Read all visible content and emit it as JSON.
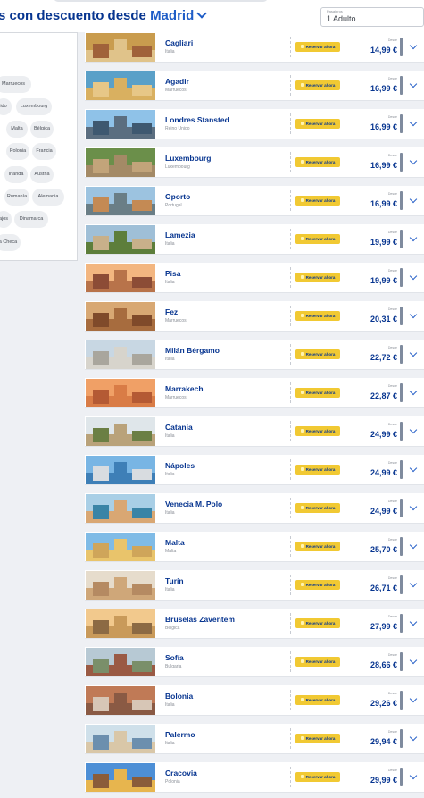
{
  "header": {
    "title_prefix": "s con descuento desde",
    "origin": "Madrid",
    "passengers_label": "Pasajeros",
    "passengers_value": "1 Adulto"
  },
  "filters": [
    {
      "label": "Marruecos"
    },
    {
      "label": "ido"
    },
    {
      "label": "Luxembourg"
    },
    {
      "label": "Malta"
    },
    {
      "label": "Bélgica"
    },
    {
      "label": "Polonia"
    },
    {
      "label": "Francia"
    },
    {
      "label": "Irlanda"
    },
    {
      "label": "Austria"
    },
    {
      "label": "Rumanía"
    },
    {
      "label": "Alemania"
    },
    {
      "label": "ajos"
    },
    {
      "label": "Dinamarca"
    },
    {
      "label": "a Checa"
    }
  ],
  "common": {
    "book_label": "Reservar ahora",
    "from_label": "Desde"
  },
  "destinations": [
    {
      "name": "Cagliari",
      "country": "Italia",
      "price": "14,99 €",
      "colors": [
        "#c99c4e",
        "#e0c38a",
        "#a0623a"
      ]
    },
    {
      "name": "Agadir",
      "country": "Marruecos",
      "price": "16,99 €",
      "colors": [
        "#5aa0c8",
        "#d9b060",
        "#e7c787"
      ]
    },
    {
      "name": "Londres Stansted",
      "country": "Reino Unido",
      "price": "16,99 €",
      "colors": [
        "#8fc2e8",
        "#5b6e80",
        "#3e5870"
      ]
    },
    {
      "name": "Luxembourg",
      "country": "Luxembourg",
      "price": "16,99 €",
      "colors": [
        "#6b8f4a",
        "#a48a66",
        "#c2a47a"
      ]
    },
    {
      "name": "Oporto",
      "country": "Portugal",
      "price": "16,99 €",
      "colors": [
        "#9cc3e0",
        "#6a7e86",
        "#c48a54"
      ]
    },
    {
      "name": "Lamezia",
      "country": "Italia",
      "price": "19,99 €",
      "colors": [
        "#9fbfd7",
        "#5d7e3b",
        "#c8b08a"
      ]
    },
    {
      "name": "Pisa",
      "country": "Italia",
      "price": "19,99 €",
      "colors": [
        "#f3b680",
        "#b8734a",
        "#8c4c36"
      ]
    },
    {
      "name": "Fez",
      "country": "Marruecos",
      "price": "20,31 €",
      "colors": [
        "#d8a873",
        "#a76c3e",
        "#7f4a2a"
      ]
    },
    {
      "name": "Milán Bérgamo",
      "country": "Italia",
      "price": "22,72 €",
      "colors": [
        "#c8d7e3",
        "#d7d4cc",
        "#a9a69d"
      ]
    },
    {
      "name": "Marrakech",
      "country": "Marruecos",
      "price": "22,87 €",
      "colors": [
        "#f0a066",
        "#d97c46",
        "#b45a34"
      ]
    },
    {
      "name": "Catania",
      "country": "Italia",
      "price": "24,99 €",
      "colors": [
        "#dfe6ea",
        "#b9a27a",
        "#6b7f44"
      ]
    },
    {
      "name": "Nápoles",
      "country": "Italia",
      "price": "24,99 €",
      "colors": [
        "#78b5e4",
        "#3e7fb7",
        "#d8dce0"
      ]
    },
    {
      "name": "Venecia M. Polo",
      "country": "Italia",
      "price": "24,99 €",
      "colors": [
        "#a9cfe6",
        "#d9a773",
        "#3a84a6"
      ]
    },
    {
      "name": "Malta",
      "country": "Malta",
      "price": "25,70 €",
      "colors": [
        "#7fbbe6",
        "#e9c46b",
        "#cfa55a"
      ]
    },
    {
      "name": "Turín",
      "country": "Italia",
      "price": "26,71 €",
      "colors": [
        "#e6dccc",
        "#cfa779",
        "#b58a62"
      ]
    },
    {
      "name": "Bruselas Zaventem",
      "country": "Bélgica",
      "price": "27,99 €",
      "colors": [
        "#f2c98d",
        "#c99a5a",
        "#8c6a44"
      ]
    },
    {
      "name": "Sofía",
      "country": "Bulgaria",
      "price": "28,66 €",
      "colors": [
        "#b7c9d4",
        "#9a5a44",
        "#7a8f6a"
      ]
    },
    {
      "name": "Bolonia",
      "country": "Italia",
      "price": "29,26 €",
      "colors": [
        "#c07a56",
        "#8a5a44",
        "#d7c6b6"
      ]
    },
    {
      "name": "Palermo",
      "country": "Italia",
      "price": "29,94 €",
      "colors": [
        "#cfe0ea",
        "#d9c7a8",
        "#6c8fae"
      ]
    },
    {
      "name": "Cracovia",
      "country": "Polonia",
      "price": "29,99 €",
      "colors": [
        "#4d8fd6",
        "#e7b54e",
        "#8a5c3a"
      ]
    }
  ]
}
